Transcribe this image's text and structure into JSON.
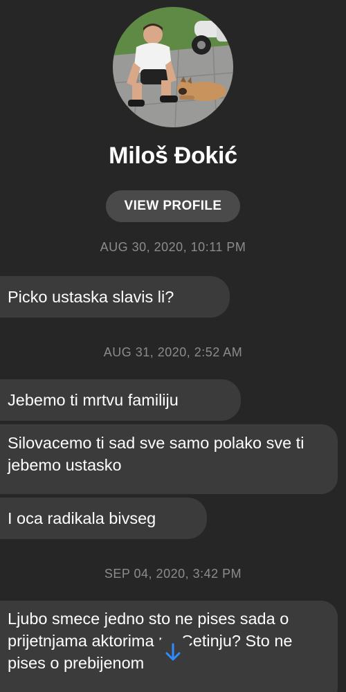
{
  "profile": {
    "name": "Miloš Đokić",
    "view_profile_label": "VIEW PROFILE"
  },
  "conversation": [
    {
      "timestamp": "AUG 30, 2020, 10:11 PM",
      "messages": [
        "Picko ustaska slavis li?"
      ]
    },
    {
      "timestamp": "AUG 31, 2020, 2:52 AM",
      "messages": [
        "Jebemo ti mrtvu familiju",
        "Silovacemo ti sad sve samo polako sve ti jebemo ustasko",
        "I oca radikala bivseg"
      ]
    },
    {
      "timestamp": "SEP 04, 2020, 3:42 PM",
      "messages": [
        "Ljubo smece jedno sto ne pises sada o prijetnjama aktorima na Cetinju? Sto ne pises o prebijenom"
      ]
    }
  ],
  "icons": {
    "scroll_down": "arrow-down-icon",
    "avatar": "profile-photo"
  },
  "colors": {
    "background": "#262626",
    "bubble": "#3b3b3b",
    "button": "#4a4a4a",
    "timestamp": "#8c8c8c",
    "accent": "#2f8cff"
  }
}
